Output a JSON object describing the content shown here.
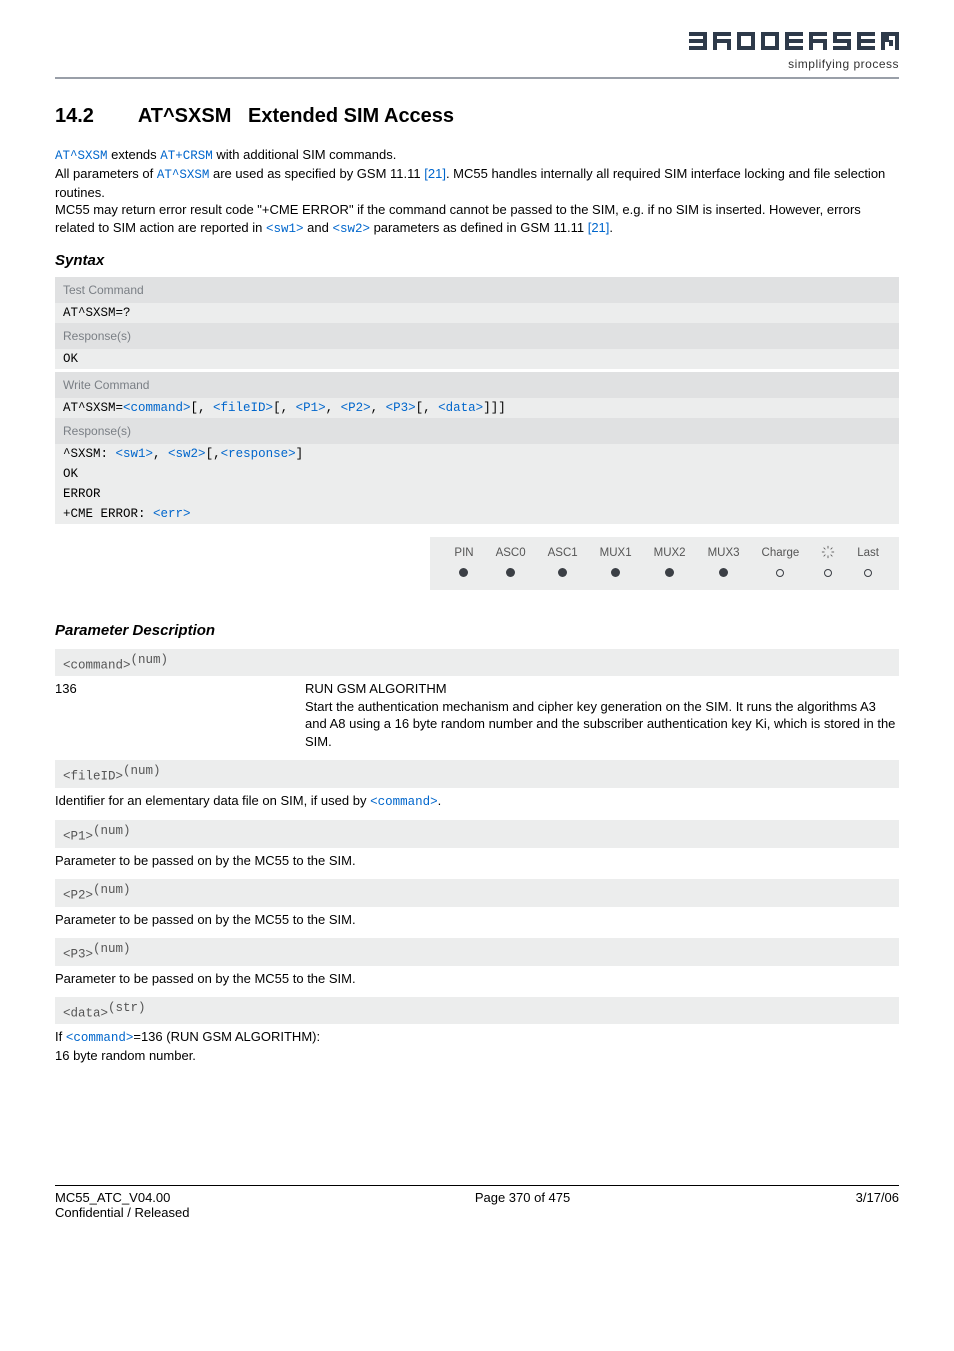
{
  "brand": "BRODERSEN",
  "tagline": "simplifying process",
  "section": {
    "number": "14.2",
    "command": "AT^SXSM",
    "title": "Extended SIM Access"
  },
  "intro": {
    "line1a": "AT^SXSM",
    "line1b": " extends ",
    "line1c": "AT+CRSM",
    "line1d": " with additional SIM commands.",
    "line2a": "All parameters of ",
    "line2b": "AT^SXSM",
    "line2c": " are used as specified by GSM 11.11 ",
    "line2d": "[21]",
    "line2e": ". MC55 handles internally all required SIM interface locking and file selection routines.",
    "line3a": "MC55 may return error result code \"+CME ERROR\" if the command cannot be passed to the SIM, e.g. if no SIM is inserted. However, errors related to SIM action are reported in ",
    "line3b": "<sw1>",
    "line3c": " and ",
    "line3d": "<sw2>",
    "line3e": " parameters as defined in GSM 11.11 ",
    "line3f": "[21]",
    "line3g": "."
  },
  "syntax": {
    "heading": "Syntax",
    "test_label": "Test Command",
    "test_cmd": "AT^SXSM=?",
    "resp_label": "Response(s)",
    "ok": "OK",
    "write_label": "Write Command",
    "write_cmd_prefix": "AT^SXSM=",
    "p_command": "<command>",
    "p_fileID": "<fileID>",
    "p_P1": "<P1>",
    "p_P2": "<P2>",
    "p_P3": "<P3>",
    "p_data": "<data>",
    "resp_prefix": "^SXSM: ",
    "p_sw1": "<sw1>",
    "p_sw2": "<sw2>",
    "p_response": "<response>",
    "error": "ERROR",
    "cme_prefix": "+CME ERROR: ",
    "p_err": "<err>"
  },
  "pin_row": {
    "cols": [
      "PIN",
      "ASC0",
      "ASC1",
      "MUX1",
      "MUX2",
      "MUX3",
      "Charge",
      "",
      "Last"
    ]
  },
  "params": {
    "heading": "Parameter Description",
    "command": {
      "tag": "<command>",
      "sup": "(num)",
      "val": "136",
      "desc_title": "RUN GSM ALGORITHM",
      "desc_body": "Start the authentication mechanism and cipher key generation on the SIM. It runs the algorithms A3 and A8 using a 16 byte random number and the subscriber authentication key Ki, which is stored in the SIM."
    },
    "fileID": {
      "tag": "<fileID>",
      "sup": "(num)",
      "desc_a": "Identifier for an elementary data file on SIM, if used by ",
      "desc_b": "<command>",
      "desc_c": "."
    },
    "P1": {
      "tag": "<P1>",
      "sup": "(num)",
      "desc": "Parameter to be passed on by the MC55 to the SIM."
    },
    "P2": {
      "tag": "<P2>",
      "sup": "(num)",
      "desc": "Parameter to be passed on by the MC55 to the SIM."
    },
    "P3": {
      "tag": "<P3>",
      "sup": "(num)",
      "desc": "Parameter to be passed on by the MC55 to the SIM."
    },
    "data": {
      "tag": "<data>",
      "sup": "(str)",
      "desc_a": "If ",
      "desc_b": "<command>",
      "desc_c": "=136 (RUN GSM ALGORITHM):",
      "desc_d": "16 byte random number."
    }
  },
  "footer": {
    "left1": "MC55_ATC_V04.00",
    "left2": "Confidential / Released",
    "center": "Page 370 of 475",
    "right": "3/17/06"
  }
}
